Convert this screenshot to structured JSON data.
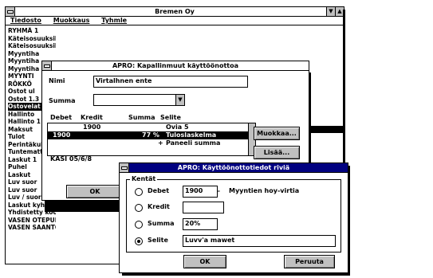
{
  "main_window": {
    "title": "Bremen Oy",
    "menu": [
      "Tiedosto",
      "Muokkaus",
      "Tyhmle"
    ],
    "list_lines": [
      "RYHMÄ 1",
      "Käteisosuuksilla maxim 30 %",
      "Käteisosuuksilla 1 %, jälkeen",
      "Myyntiha",
      "Myyntiha",
      "Myyntiha",
      "MYYNTI",
      "RÖKKÖ",
      "Ostot ul",
      "Ostot 1.3",
      "Ostovelat",
      "Hallinto",
      "Hallinto 1",
      "Maksut",
      "Tulot",
      "Perintäkulut",
      "Tuntemattomat",
      "Laskut 1",
      "Puhel",
      "Laskut",
      "Luv suor",
      "Luv suor",
      "Luv / suorit",
      "Laskut kyhmässä",
      "Yhdistetty koodi",
      "VASEN OTEPURO",
      "VASEN SAANTO"
    ]
  },
  "dialog1": {
    "title": "APRO: Kapallinmuut käyttöönottoa",
    "name_label": "Nimi",
    "name_value": "Virtalhnen ente",
    "type_label": "Summa",
    "col_headers": [
      "Debet",
      "Kredit",
      "Summa",
      "Selite"
    ],
    "rows": [
      [
        "1900",
        "",
        "",
        "Ovia 5"
      ],
      [
        "1900",
        "",
        "77 %",
        "Tuloslaskelma"
      ],
      [
        "",
        "",
        "",
        "Paneeli summa"
      ]
    ],
    "footer_text": "KASI 05/6/8",
    "btn_modify": "Muokkaa...",
    "btn_add": "Lisää...",
    "btn_ok": "OK"
  },
  "dialog2": {
    "title": "APRO: Käyttöönottotiedot riviä",
    "group_label": "Kentät",
    "rows": [
      {
        "label": "Debet",
        "value": "1900",
        "selected": false,
        "note": "Myyntien hoy-virtia"
      },
      {
        "label": "Kredit",
        "value": "",
        "selected": false,
        "note": ""
      },
      {
        "label": "Summa",
        "value": "20%",
        "selected": false,
        "note": ""
      },
      {
        "label": "Selite",
        "value": "Luvv'a mawet",
        "selected": true,
        "note": ""
      }
    ],
    "btn_ok": "OK",
    "btn_cancel": "Peruuta"
  }
}
